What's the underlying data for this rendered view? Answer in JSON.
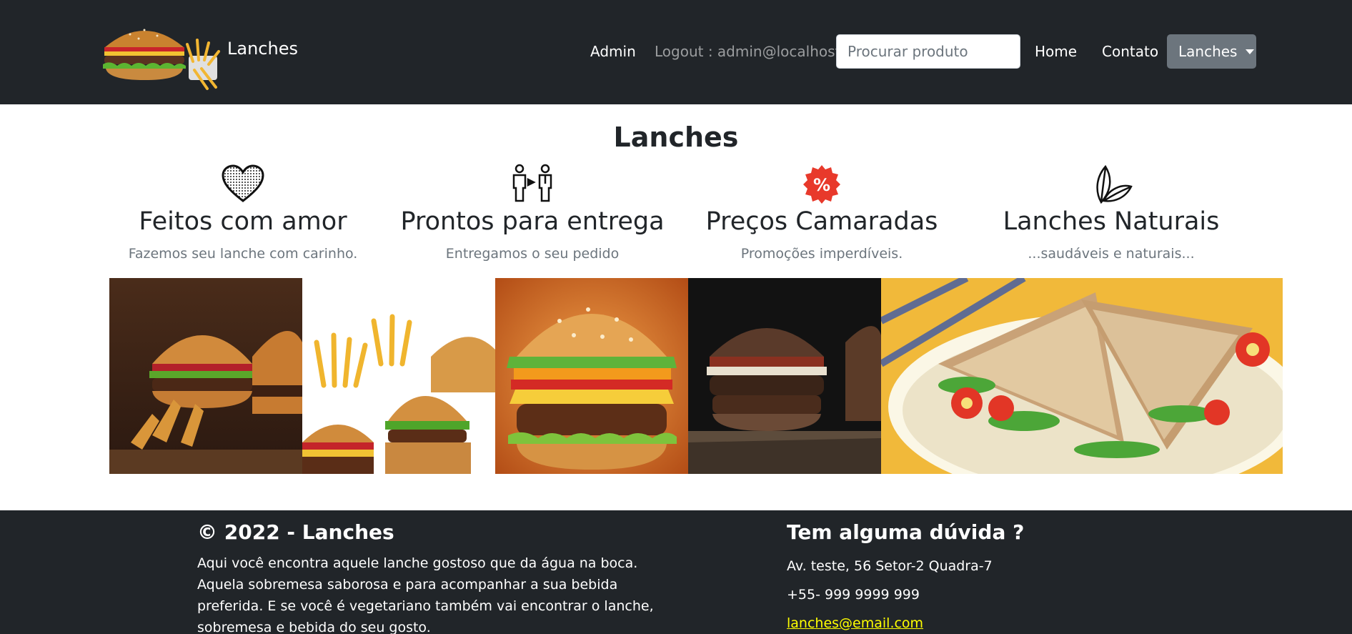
{
  "navbar": {
    "brand_name": "Lanches",
    "admin_label": "Admin",
    "logout_label": "Logout : admin@localhost",
    "search_placeholder": "Procurar produto",
    "home_label": "Home",
    "contact_label": "Contato",
    "dropdown_label": "Lanches"
  },
  "main": {
    "title": "Lanches",
    "features": [
      {
        "icon": "heart-icon",
        "title": "Feitos com amor",
        "subtitle": "Fazemos seu lanche com carinho."
      },
      {
        "icon": "delivery-people-icon",
        "title": "Prontos para entrega",
        "subtitle": "Entregamos o seu pedido"
      },
      {
        "icon": "percent-badge-icon",
        "title": "Preços Camaradas",
        "subtitle": "Promoções imperdíveis."
      },
      {
        "icon": "leaf-icon",
        "title": "Lanches Naturais",
        "subtitle": "...saudáveis e naturais..."
      }
    ]
  },
  "footer": {
    "copyright": "© 2022 - Lanches",
    "about": "Aqui você encontra aquele lanche gostoso que da água na boca. Aquela sobremesa saborosa e para acompanhar a sua bebida preferida. E se você é vegetariano também vai encontrar o lanche, sobremesa e bebida do seu gosto.",
    "question_title": "Tem alguma dúvida ?",
    "address": "Av. teste, 56 Setor-2 Quadra-7",
    "phone": "+55- 999 9999 999",
    "email": "lanches@email.com"
  },
  "colors": {
    "navbar_bg": "#212529",
    "dropdown_bg": "#6c757d",
    "email_link": "#ffff00",
    "badge_red": "#e8392b"
  }
}
